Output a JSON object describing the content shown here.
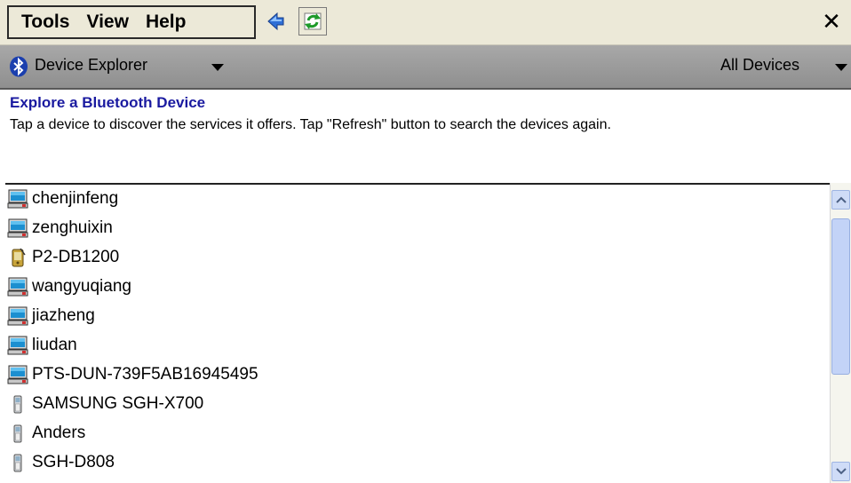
{
  "menu": {
    "tools": "Tools",
    "view": "View",
    "help": "Help"
  },
  "toolbar": {
    "back_icon": "back-arrow-icon",
    "refresh_icon": "refresh-icon",
    "close_label": "✕"
  },
  "nav": {
    "title": "Device Explorer",
    "filter": "All Devices"
  },
  "header": {
    "heading": "Explore a Bluetooth Device",
    "description": "Tap a device to discover the services it offers. Tap \"Refresh\" button to search the devices again."
  },
  "devices": [
    {
      "name": "chenjinfeng",
      "icon": "computer"
    },
    {
      "name": "zenghuixin",
      "icon": "computer"
    },
    {
      "name": "P2-DB1200",
      "icon": "pda"
    },
    {
      "name": "wangyuqiang",
      "icon": "computer"
    },
    {
      "name": "jiazheng",
      "icon": "computer"
    },
    {
      "name": "liudan",
      "icon": "computer"
    },
    {
      "name": "PTS-DUN-739F5AB16945495",
      "icon": "computer"
    },
    {
      "name": "SAMSUNG SGH-X700",
      "icon": "phone"
    },
    {
      "name": "Anders",
      "icon": "phone"
    },
    {
      "name": "SGH-D808",
      "icon": "phone"
    }
  ],
  "colors": {
    "heading": "#1a1aa0",
    "menubar": "#ece9d8",
    "navbar": "#9c9c9c",
    "scrollbar_thumb": "#c3d3f7"
  }
}
